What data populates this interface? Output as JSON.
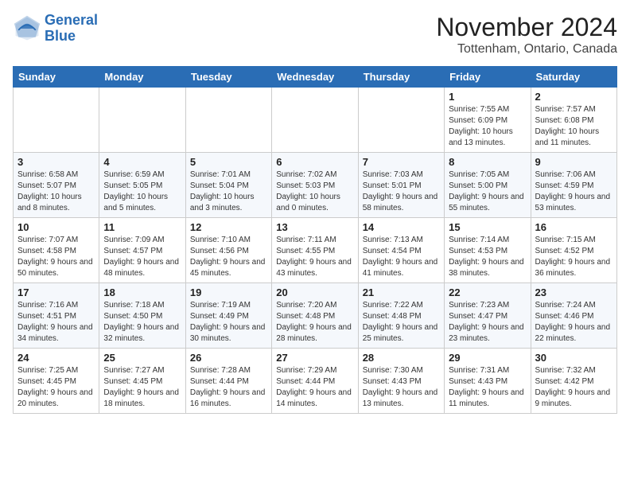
{
  "logo": {
    "line1": "General",
    "line2": "Blue"
  },
  "title": "November 2024",
  "location": "Tottenham, Ontario, Canada",
  "weekdays": [
    "Sunday",
    "Monday",
    "Tuesday",
    "Wednesday",
    "Thursday",
    "Friday",
    "Saturday"
  ],
  "weeks": [
    [
      {
        "day": "",
        "info": ""
      },
      {
        "day": "",
        "info": ""
      },
      {
        "day": "",
        "info": ""
      },
      {
        "day": "",
        "info": ""
      },
      {
        "day": "",
        "info": ""
      },
      {
        "day": "1",
        "info": "Sunrise: 7:55 AM\nSunset: 6:09 PM\nDaylight: 10 hours and 13 minutes."
      },
      {
        "day": "2",
        "info": "Sunrise: 7:57 AM\nSunset: 6:08 PM\nDaylight: 10 hours and 11 minutes."
      }
    ],
    [
      {
        "day": "3",
        "info": "Sunrise: 6:58 AM\nSunset: 5:07 PM\nDaylight: 10 hours and 8 minutes."
      },
      {
        "day": "4",
        "info": "Sunrise: 6:59 AM\nSunset: 5:05 PM\nDaylight: 10 hours and 5 minutes."
      },
      {
        "day": "5",
        "info": "Sunrise: 7:01 AM\nSunset: 5:04 PM\nDaylight: 10 hours and 3 minutes."
      },
      {
        "day": "6",
        "info": "Sunrise: 7:02 AM\nSunset: 5:03 PM\nDaylight: 10 hours and 0 minutes."
      },
      {
        "day": "7",
        "info": "Sunrise: 7:03 AM\nSunset: 5:01 PM\nDaylight: 9 hours and 58 minutes."
      },
      {
        "day": "8",
        "info": "Sunrise: 7:05 AM\nSunset: 5:00 PM\nDaylight: 9 hours and 55 minutes."
      },
      {
        "day": "9",
        "info": "Sunrise: 7:06 AM\nSunset: 4:59 PM\nDaylight: 9 hours and 53 minutes."
      }
    ],
    [
      {
        "day": "10",
        "info": "Sunrise: 7:07 AM\nSunset: 4:58 PM\nDaylight: 9 hours and 50 minutes."
      },
      {
        "day": "11",
        "info": "Sunrise: 7:09 AM\nSunset: 4:57 PM\nDaylight: 9 hours and 48 minutes."
      },
      {
        "day": "12",
        "info": "Sunrise: 7:10 AM\nSunset: 4:56 PM\nDaylight: 9 hours and 45 minutes."
      },
      {
        "day": "13",
        "info": "Sunrise: 7:11 AM\nSunset: 4:55 PM\nDaylight: 9 hours and 43 minutes."
      },
      {
        "day": "14",
        "info": "Sunrise: 7:13 AM\nSunset: 4:54 PM\nDaylight: 9 hours and 41 minutes."
      },
      {
        "day": "15",
        "info": "Sunrise: 7:14 AM\nSunset: 4:53 PM\nDaylight: 9 hours and 38 minutes."
      },
      {
        "day": "16",
        "info": "Sunrise: 7:15 AM\nSunset: 4:52 PM\nDaylight: 9 hours and 36 minutes."
      }
    ],
    [
      {
        "day": "17",
        "info": "Sunrise: 7:16 AM\nSunset: 4:51 PM\nDaylight: 9 hours and 34 minutes."
      },
      {
        "day": "18",
        "info": "Sunrise: 7:18 AM\nSunset: 4:50 PM\nDaylight: 9 hours and 32 minutes."
      },
      {
        "day": "19",
        "info": "Sunrise: 7:19 AM\nSunset: 4:49 PM\nDaylight: 9 hours and 30 minutes."
      },
      {
        "day": "20",
        "info": "Sunrise: 7:20 AM\nSunset: 4:48 PM\nDaylight: 9 hours and 28 minutes."
      },
      {
        "day": "21",
        "info": "Sunrise: 7:22 AM\nSunset: 4:48 PM\nDaylight: 9 hours and 25 minutes."
      },
      {
        "day": "22",
        "info": "Sunrise: 7:23 AM\nSunset: 4:47 PM\nDaylight: 9 hours and 23 minutes."
      },
      {
        "day": "23",
        "info": "Sunrise: 7:24 AM\nSunset: 4:46 PM\nDaylight: 9 hours and 22 minutes."
      }
    ],
    [
      {
        "day": "24",
        "info": "Sunrise: 7:25 AM\nSunset: 4:45 PM\nDaylight: 9 hours and 20 minutes."
      },
      {
        "day": "25",
        "info": "Sunrise: 7:27 AM\nSunset: 4:45 PM\nDaylight: 9 hours and 18 minutes."
      },
      {
        "day": "26",
        "info": "Sunrise: 7:28 AM\nSunset: 4:44 PM\nDaylight: 9 hours and 16 minutes."
      },
      {
        "day": "27",
        "info": "Sunrise: 7:29 AM\nSunset: 4:44 PM\nDaylight: 9 hours and 14 minutes."
      },
      {
        "day": "28",
        "info": "Sunrise: 7:30 AM\nSunset: 4:43 PM\nDaylight: 9 hours and 13 minutes."
      },
      {
        "day": "29",
        "info": "Sunrise: 7:31 AM\nSunset: 4:43 PM\nDaylight: 9 hours and 11 minutes."
      },
      {
        "day": "30",
        "info": "Sunrise: 7:32 AM\nSunset: 4:42 PM\nDaylight: 9 hours and 9 minutes."
      }
    ]
  ]
}
